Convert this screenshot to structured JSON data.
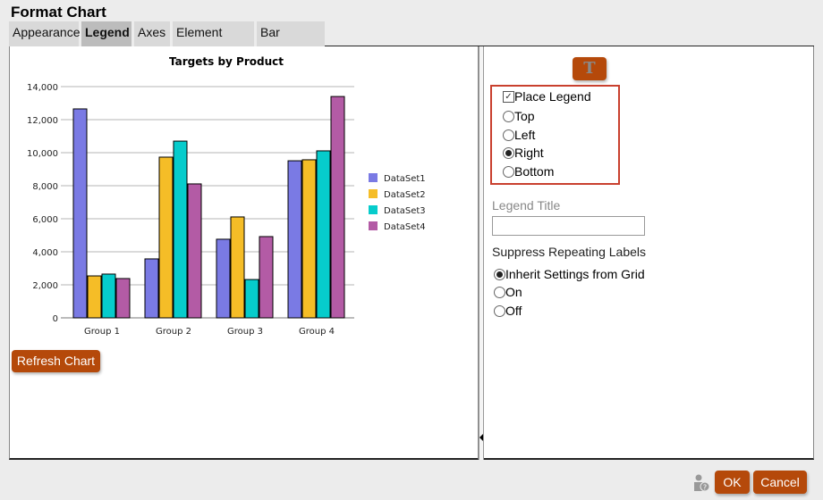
{
  "dialog": {
    "title": "Format Chart"
  },
  "tabs": [
    {
      "label": "Appearance"
    },
    {
      "label": "Legend"
    },
    {
      "label": "Axes"
    },
    {
      "label": "Element Style"
    },
    {
      "label": "Bar Options"
    }
  ],
  "chart_panel": {
    "refresh_label": "Refresh Chart"
  },
  "chart_data": {
    "type": "bar",
    "title": "Targets by Product",
    "categories": [
      "Group 1",
      "Group 2",
      "Group 3",
      "Group 4"
    ],
    "series": [
      {
        "name": "DataSet1",
        "color": "#7a7ae4",
        "values": [
          12650,
          3570,
          4760,
          9510
        ]
      },
      {
        "name": "DataSet2",
        "color": "#f5bd27",
        "values": [
          2540,
          9730,
          6110,
          9570
        ]
      },
      {
        "name": "DataSet3",
        "color": "#06cccc",
        "values": [
          2650,
          10700,
          2320,
          10110
        ]
      },
      {
        "name": "DataSet4",
        "color": "#b35ba5",
        "values": [
          2380,
          8110,
          4920,
          13400
        ]
      }
    ],
    "ylim": [
      0,
      14000
    ],
    "yticks": [
      "0",
      "2,000",
      "4,000",
      "6,000",
      "8,000",
      "10,000",
      "12,000",
      "14,000"
    ],
    "legend_position": "right",
    "grid": true
  },
  "legend_options": {
    "font_button": "T",
    "place_legend_label": "Place Legend",
    "place_legend_checked": true,
    "positions": [
      {
        "label": "Top"
      },
      {
        "label": "Left"
      },
      {
        "label": "Right"
      },
      {
        "label": "Bottom"
      }
    ],
    "selected_position": "Right",
    "legend_title_label": "Legend Title",
    "legend_title_value": "",
    "suppress_label": "Suppress Repeating Labels",
    "suppress_options": [
      {
        "label": "Inherit Settings from Grid"
      },
      {
        "label": "On"
      },
      {
        "label": "Off"
      }
    ],
    "suppress_selected": "Inherit Settings from Grid"
  },
  "footer": {
    "ok_label": "OK",
    "cancel_label": "Cancel"
  }
}
